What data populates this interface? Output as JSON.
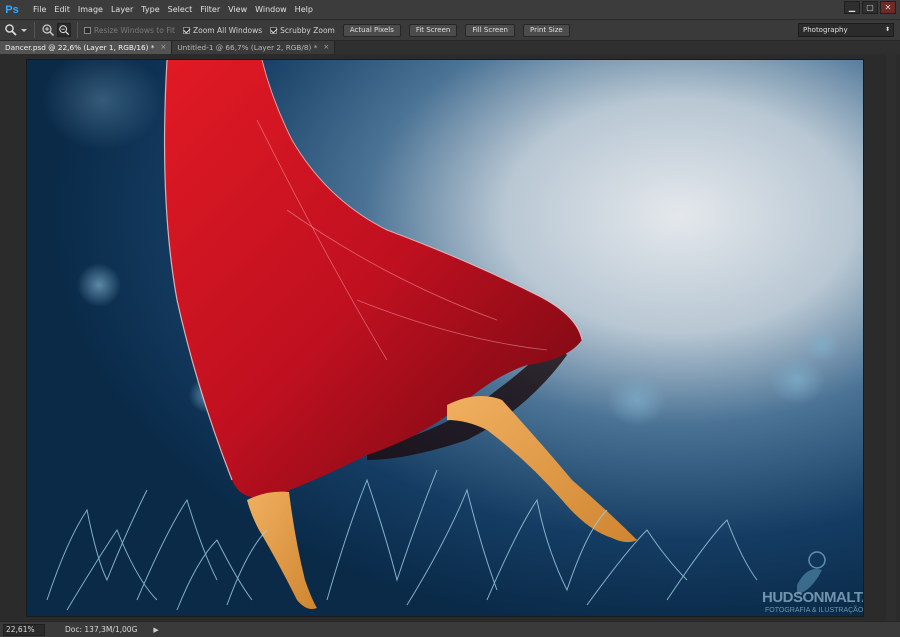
{
  "app": {
    "logo": "Ps"
  },
  "menu": [
    "File",
    "Edit",
    "Image",
    "Layer",
    "Type",
    "Select",
    "Filter",
    "View",
    "Window",
    "Help"
  ],
  "window_controls": {
    "minimize": "▁",
    "maximize": "▢",
    "close": "✕"
  },
  "options": {
    "resize_windows": {
      "label": "Resize Windows to Fit",
      "checked": false
    },
    "zoom_all": {
      "label": "Zoom All Windows",
      "checked": true
    },
    "scrubby_zoom": {
      "label": "Scrubby Zoom",
      "checked": true
    },
    "actual_pixels": "Actual Pixels",
    "fit_screen": "Fit Screen",
    "fill_screen": "Fill Screen",
    "print_size": "Print Size",
    "workspace": "Photography"
  },
  "tabs": [
    {
      "label": "Dancer.psd @ 22,6% (Layer 1, RGB/16) *",
      "close": "×",
      "active": true
    },
    {
      "label": "Untitled-1 @ 66,7% (Layer 2, RGB/8) *",
      "close": "×",
      "active": false
    }
  ],
  "watermark": {
    "name": "HUDSONMALTA",
    "tagline": "FOTOGRAFIA & ILUSTRAÇÃO"
  },
  "status": {
    "zoom": "22,61%",
    "doc": "Doc: 137,3M/1,00G",
    "arrow": "▶"
  },
  "colors": {
    "accent": "#31a8ff",
    "dress": "#c8101c",
    "background": "#0e3456"
  }
}
